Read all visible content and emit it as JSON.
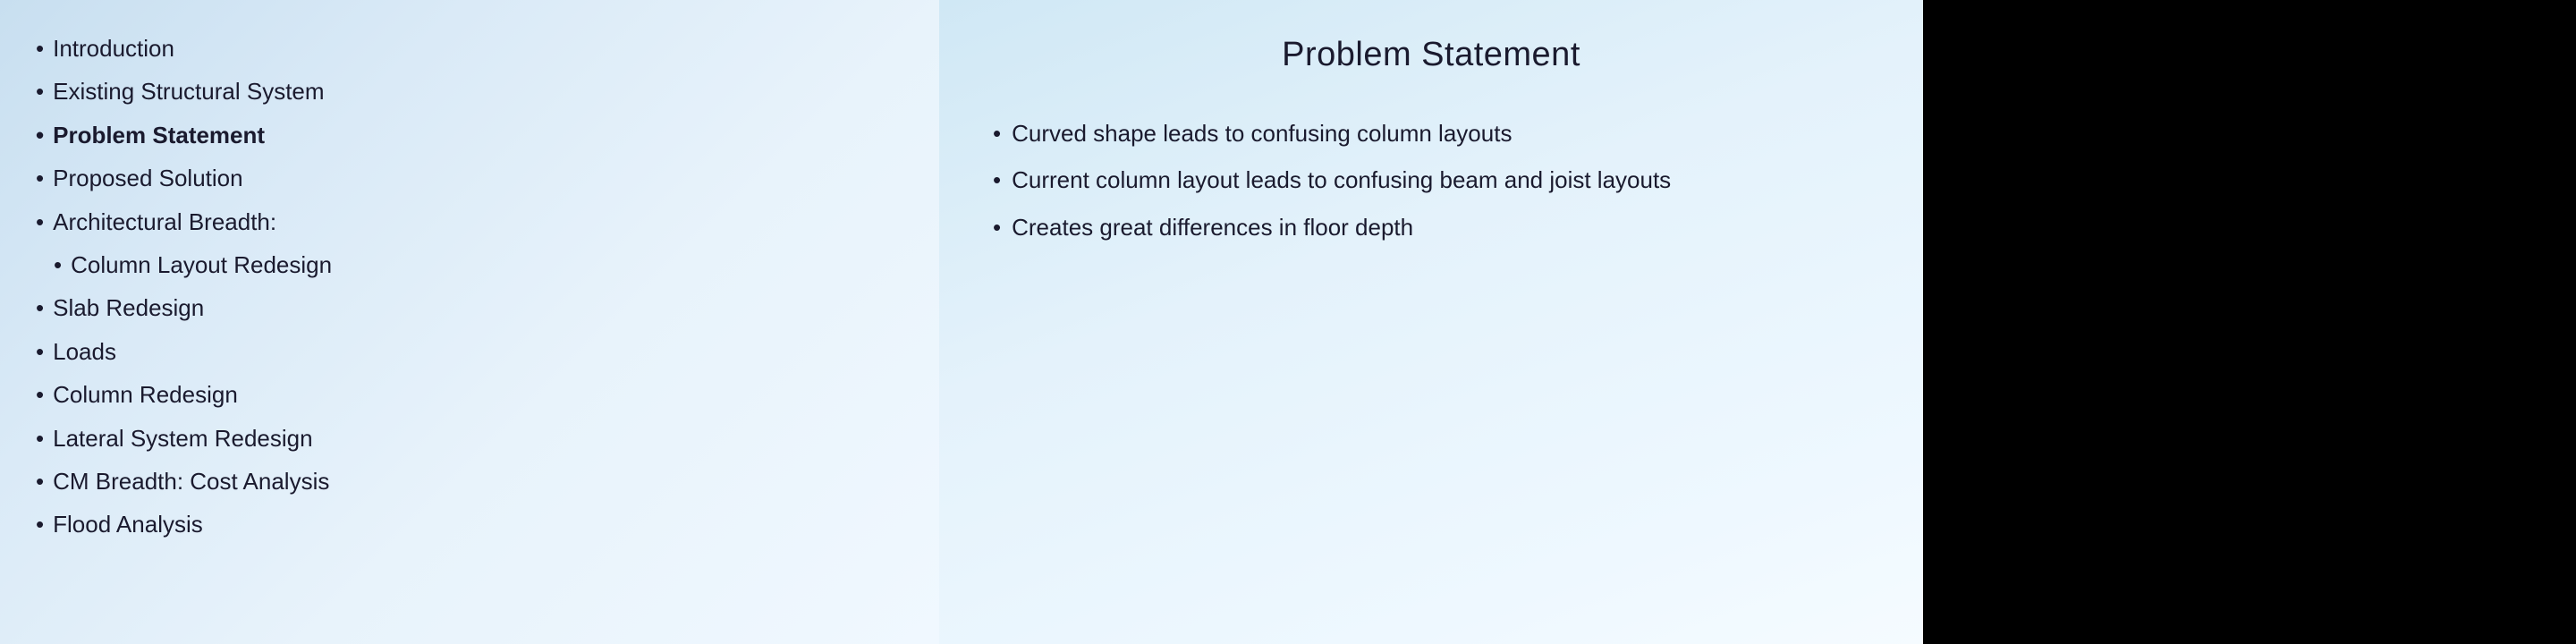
{
  "leftPanel": {
    "navItems": [
      {
        "id": "introduction",
        "label": "Introduction",
        "bold": false,
        "indent": false
      },
      {
        "id": "existing-structural-system",
        "label": "Existing Structural System",
        "bold": false,
        "indent": false
      },
      {
        "id": "problem-statement",
        "label": "Problem Statement",
        "bold": true,
        "indent": false
      },
      {
        "id": "proposed-solution",
        "label": "Proposed Solution",
        "bold": false,
        "indent": false
      },
      {
        "id": "architectural-breadth",
        "label": "Architectural Breadth:",
        "bold": false,
        "indent": false
      },
      {
        "id": "column-layout-redesign",
        "label": "Column Layout Redesign",
        "bold": false,
        "indent": true
      },
      {
        "id": "slab-redesign",
        "label": "Slab Redesign",
        "bold": false,
        "indent": false
      },
      {
        "id": "loads",
        "label": "Loads",
        "bold": false,
        "indent": false
      },
      {
        "id": "column-redesign",
        "label": "Column Redesign",
        "bold": false,
        "indent": false
      },
      {
        "id": "lateral-system-redesign",
        "label": "Lateral System Redesign",
        "bold": false,
        "indent": false
      },
      {
        "id": "cm-breadth-cost-analysis",
        "label": "CM Breadth: Cost Analysis",
        "bold": false,
        "indent": false
      },
      {
        "id": "flood-analysis",
        "label": "Flood Analysis",
        "bold": false,
        "indent": false
      }
    ]
  },
  "mainContent": {
    "title": "Problem Statement",
    "bulletPoints": [
      "Curved shape leads to confusing column layouts",
      "Current column layout leads to confusing beam and joist layouts",
      "Creates great differences in floor depth"
    ]
  }
}
